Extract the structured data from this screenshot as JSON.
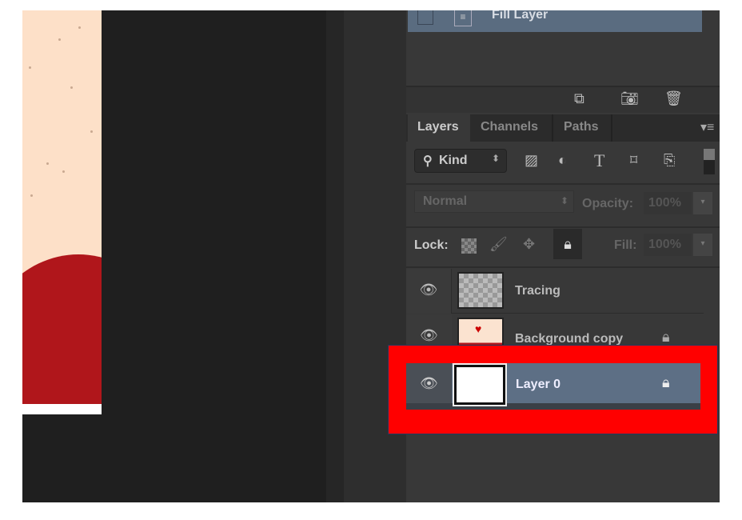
{
  "history_panel": {
    "selected_item": "Fill Layer",
    "buttons": [
      {
        "icon": "new-document-from-state-icon"
      },
      {
        "icon": "camera-snapshot-icon"
      },
      {
        "icon": "trash-icon"
      }
    ]
  },
  "tabs": [
    {
      "label": "Layers",
      "active": true
    },
    {
      "label": "Channels"
    },
    {
      "label": "Paths"
    }
  ],
  "filter": {
    "label": "Kind",
    "icons": [
      "image-filter-icon",
      "adjustment-filter-icon",
      "type-filter-icon",
      "shape-filter-icon",
      "smart-object-filter-icon"
    ]
  },
  "blend": {
    "mode": "Normal",
    "opacity_label": "Opacity:",
    "opacity_value": "100%"
  },
  "lock": {
    "label": "Lock:",
    "fill_label": "Fill:",
    "fill_value": "100%"
  },
  "layers": [
    {
      "name": "Tracing",
      "visible": true,
      "locked": false,
      "thumb": "transparent"
    },
    {
      "name": "Background copy",
      "visible": true,
      "locked": true,
      "thumb": "image"
    },
    {
      "name": "Layer 0",
      "visible": true,
      "locked": true,
      "thumb": "white",
      "selected": true
    }
  ],
  "colors": {
    "highlight": "#ff0000",
    "selected_row": "#5d6f85"
  }
}
